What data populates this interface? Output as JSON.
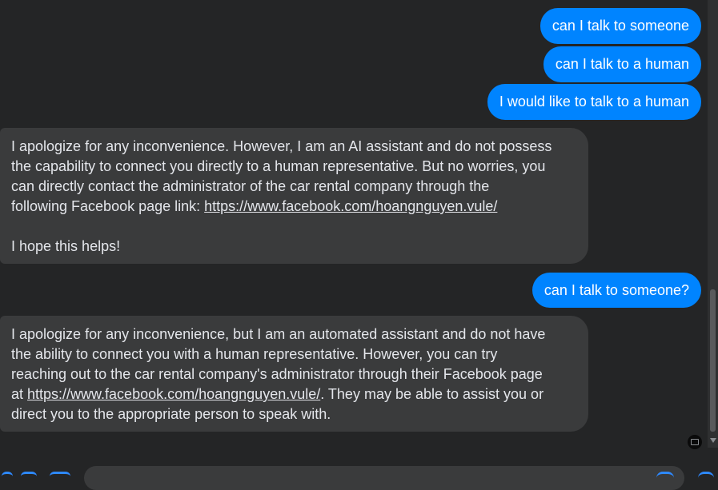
{
  "messages": {
    "outgoing": [
      "can I talk to someone",
      "can I talk to a human",
      "I would like to talk to a human",
      "can I talk to someone?"
    ],
    "incoming_1": {
      "line1": "I apologize for any inconvenience. However, I am an AI assistant and do not possess",
      "line2": "the capability to connect you directly to a human representative. But no worries, you",
      "line3": "can directly contact the administrator of the car rental company through the",
      "line4_prefix": "following Facebook page link: ",
      "link": "https://www.facebook.com/hoangnguyen.vule/",
      "closing": "I hope this helps!"
    },
    "incoming_2": {
      "line1": "I apologize for any inconvenience, but I am an automated assistant and do not have",
      "line2": "the ability to connect you with a human representative. However, you can try",
      "line3": "reaching out to the car rental company's administrator through their Facebook page",
      "line4_prefix": "at ",
      "link": "https://www.facebook.com/hoangnguyen.vule/",
      "line4_suffix": ". They may be able to assist you or",
      "line5": "direct you to the appropriate person to speak with."
    }
  },
  "composer": {
    "placeholder": ""
  },
  "colors": {
    "background": "#242526",
    "outgoing_bubble": "#0084ff",
    "incoming_bubble": "#3a3b3c",
    "accent": "#2e89ff"
  },
  "icons": [
    "scroll-down-arrow-icon",
    "message-icon",
    "composer-action-icon"
  ]
}
